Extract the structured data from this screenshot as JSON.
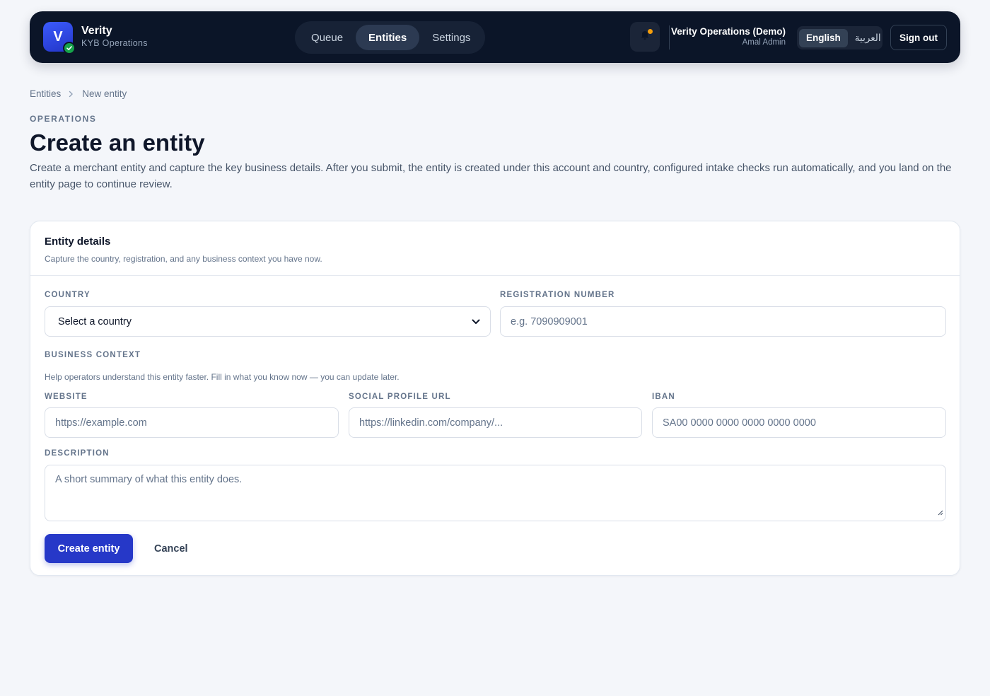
{
  "app": {
    "name": "Verity",
    "subtitle": "KYB Operations",
    "logo_letter": "V"
  },
  "nav": {
    "items": [
      {
        "label": "Queue"
      },
      {
        "label": "Entities"
      },
      {
        "label": "Settings"
      }
    ],
    "active": "Entities"
  },
  "account": {
    "org": "Verity Operations (Demo)",
    "user": "Amal Admin"
  },
  "language": {
    "options": [
      "English",
      "العربية"
    ],
    "selected": "English"
  },
  "header": {
    "sign_out": "Sign out"
  },
  "breadcrumb": {
    "items": [
      "Entities",
      "New entity"
    ]
  },
  "page": {
    "eyebrow": "OPERATIONS",
    "title": "Create an entity",
    "description": "Create a merchant entity and capture the key business details. After you submit, the entity is created under this account and country, configured intake checks run automatically, and you land on the entity page to continue review."
  },
  "form": {
    "card_title": "Entity details",
    "card_subtitle": "Capture the country, registration, and any business context you have now.",
    "country": {
      "label": "COUNTRY",
      "value": "Select a country"
    },
    "registration": {
      "label": "REGISTRATION NUMBER",
      "placeholder": "e.g. 7090909001"
    },
    "business_context": {
      "label": "BUSINESS CONTEXT",
      "helper": "Help operators understand this entity faster. Fill in what you know now — you can update later."
    },
    "website": {
      "label": "WEBSITE",
      "placeholder": "https://example.com"
    },
    "social": {
      "label": "SOCIAL PROFILE URL",
      "placeholder": "https://linkedin.com/company/..."
    },
    "iban": {
      "label": "IBAN",
      "placeholder": "SA00 0000 0000 0000 0000 0000"
    },
    "description": {
      "label": "DESCRIPTION",
      "placeholder": "A short summary of what this entity does."
    },
    "submit": "Create entity",
    "cancel": "Cancel"
  },
  "colors": {
    "topbar": "#0b1528",
    "accent": "#2638c8",
    "badge_green": "#16a34a",
    "notification_dot": "#f59e0b"
  }
}
